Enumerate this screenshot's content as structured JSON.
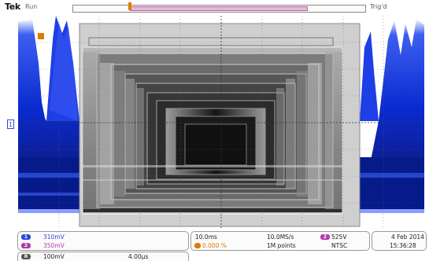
{
  "header": {
    "brand": "Tek",
    "run_state": "Run",
    "trigger_status": "Trig'd"
  },
  "channels": [
    {
      "id": "1",
      "scale": "310mV",
      "color": "#2a4ad8"
    },
    {
      "id": "2",
      "scale": "350mV",
      "color": "#b03aa8"
    }
  ],
  "math": {
    "id": "R",
    "scale": "100mV",
    "time": "4.00µs"
  },
  "timebase": {
    "horizontal_scale": "10.0ms",
    "delay": "0.000 %",
    "sample_rate": "10.0MS/s",
    "record_length": "1M points"
  },
  "trigger": {
    "source": "2",
    "level": "525V",
    "mode": "NTSC"
  },
  "datetime": {
    "date": "4 Feb 2014",
    "time": "15:36:28"
  },
  "colors": {
    "ch1": "#2a4ad8",
    "ch2": "#b03aa8",
    "trigger": "#e07a00",
    "grid": "#6a6a6a"
  }
}
